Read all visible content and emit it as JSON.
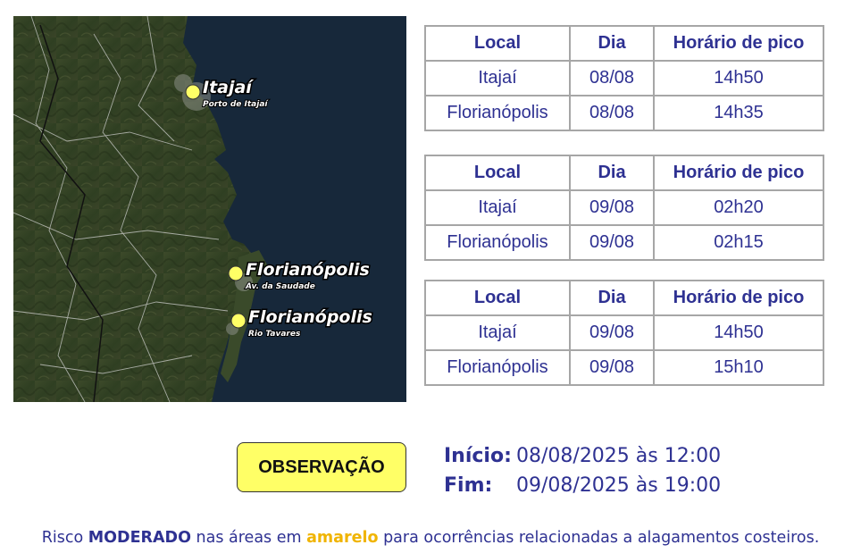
{
  "map": {
    "points": [
      {
        "name": "Itajaí",
        "sublabel": "Porto de Itajaí"
      },
      {
        "name": "Florianópolis",
        "sublabel": "Av. da Saudade"
      },
      {
        "name": "Florianópolis",
        "sublabel": "Rio Tavares"
      }
    ],
    "marker_color": "#ffff66"
  },
  "tables": [
    {
      "headers": [
        "Local",
        "Dia",
        "Horário de pico"
      ],
      "rows": [
        [
          "Itajaí",
          "08/08",
          "14h50"
        ],
        [
          "Florianópolis",
          "08/08",
          "14h35"
        ]
      ]
    },
    {
      "headers": [
        "Local",
        "Dia",
        "Horário de pico"
      ],
      "rows": [
        [
          "Itajaí",
          "09/08",
          "02h20"
        ],
        [
          "Florianópolis",
          "09/08",
          "02h15"
        ]
      ]
    },
    {
      "headers": [
        "Local",
        "Dia",
        "Horário de pico"
      ],
      "rows": [
        [
          "Itajaí",
          "09/08",
          "14h50"
        ],
        [
          "Florianópolis",
          "09/08",
          "15h10"
        ]
      ]
    }
  ],
  "observation": {
    "badge": "OBSERVAÇÃO",
    "start_label": "Início:",
    "start_value": "08/08/2025 às 12:00",
    "end_label": "Fim:",
    "end_value": "09/08/2025 às 19:00"
  },
  "footer": {
    "prefix": "Risco",
    "risk_level": "MODERADO",
    "middle": "nas áreas em",
    "color_word": "amarelo",
    "suffix": "para ocorrências relacionadas a alagamentos costeiros."
  },
  "colors": {
    "text_blue": "#2e3192",
    "highlight_yellow": "#ffff66",
    "footer_yellow": "#f0b400",
    "sea": "#17283a"
  }
}
